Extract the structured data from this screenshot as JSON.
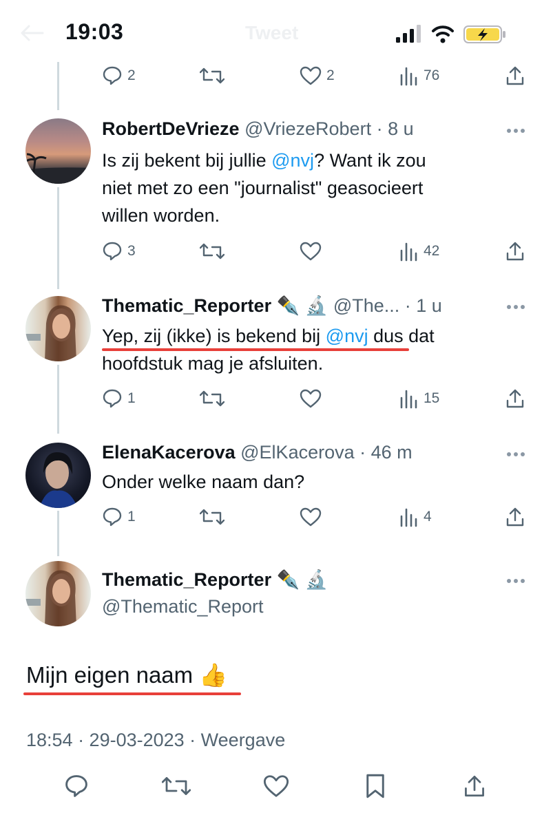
{
  "status_bar": {
    "time": "19:03",
    "title": "Tweet"
  },
  "colors": {
    "link": "#1d9bf0",
    "secondary": "#536471",
    "underline": "#e8403a",
    "thread_line": "#cfd9de"
  },
  "tweets": [
    {
      "stats": {
        "replies": "2",
        "retweets": "",
        "likes": "2",
        "views": "76"
      }
    },
    {
      "name": "RobertDeVrieze",
      "meta": "@VriezeRobert · 8 u",
      "text_lines": [
        "Is zij bekent bij jullie ",
        "@nvj",
        "? Want ik zou",
        "niet met zo een \"journalist\" geasocieert",
        "willen worden."
      ],
      "stats": {
        "replies": "3",
        "retweets": "",
        "likes": "",
        "views": "42"
      }
    },
    {
      "name": "Thematic_Reporter",
      "emoji": "✒️ 🔬",
      "meta": "@The... · 1 u",
      "text_a": "Yep, zij (ikke) is bekend bij ",
      "mention": "@nvj",
      "text_b": " dus dat",
      "text_line2": "hoofdstuk mag je afsluiten.",
      "stats": {
        "replies": "1",
        "retweets": "",
        "likes": "",
        "views": "15"
      }
    },
    {
      "name": "ElenaKacerova",
      "meta": "@ElKacerova · 46 m",
      "text": "Onder welke naam dan?",
      "stats": {
        "replies": "1",
        "retweets": "",
        "likes": "",
        "views": "4"
      }
    }
  ],
  "main_tweet": {
    "name": "Thematic_Reporter",
    "emoji": "✒️ 🔬",
    "handle": "@Thematic_Report",
    "text": "Mijn eigen naam",
    "text_emoji": "👍",
    "timestamp": "18:54 · 29-03-2023 · Weergave"
  }
}
